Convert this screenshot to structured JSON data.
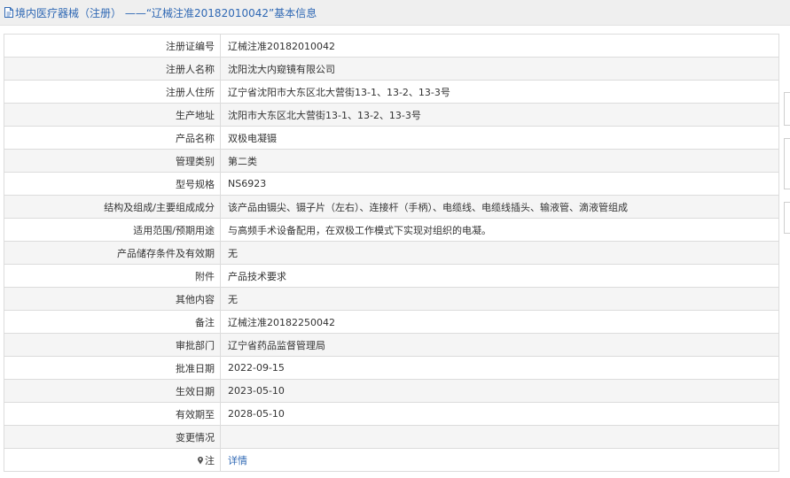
{
  "header": {
    "title": "境内医疗器械（注册） ——“辽械注准20182010042”基本信息"
  },
  "rows": [
    {
      "label": "注册证编号",
      "value": "辽械注准20182010042"
    },
    {
      "label": "注册人名称",
      "value": "沈阳沈大内窥镜有限公司"
    },
    {
      "label": "注册人住所",
      "value": "辽宁省沈阳市大东区北大营街13-1、13-2、13-3号"
    },
    {
      "label": "生产地址",
      "value": "沈阳市大东区北大营街13-1、13-2、13-3号"
    },
    {
      "label": "产品名称",
      "value": "双极电凝镊"
    },
    {
      "label": "管理类别",
      "value": "第二类"
    },
    {
      "label": "型号规格",
      "value": "NS6923"
    },
    {
      "label": "结构及组成/主要组成成分",
      "value": "该产品由镊尖、镊子片（左右）、连接杆（手柄）、电缆线、电缆线插头、输液管、滴液管组成"
    },
    {
      "label": "适用范围/预期用途",
      "value": "与高频手术设备配用，在双极工作模式下实现对组织的电凝。"
    },
    {
      "label": "产品储存条件及有效期",
      "value": "无"
    },
    {
      "label": "附件",
      "value": "产品技术要求"
    },
    {
      "label": "其他内容",
      "value": "无"
    },
    {
      "label": "备注",
      "value": "辽械注准20182250042"
    },
    {
      "label": "审批部门",
      "value": "辽宁省药品监督管理局"
    },
    {
      "label": "批准日期",
      "value": "2022-09-15"
    },
    {
      "label": "生效日期",
      "value": "2023-05-10"
    },
    {
      "label": "有效期至",
      "value": "2028-05-10"
    },
    {
      "label": "变更情况",
      "value": ""
    }
  ],
  "note_row": {
    "label": "注",
    "icon": "pin-icon",
    "link": "详情"
  },
  "colors": {
    "link": "#2f68b4",
    "title_bg": "#efefef",
    "border": "#dcdcdc",
    "row_alt": "#f5f5f5"
  }
}
